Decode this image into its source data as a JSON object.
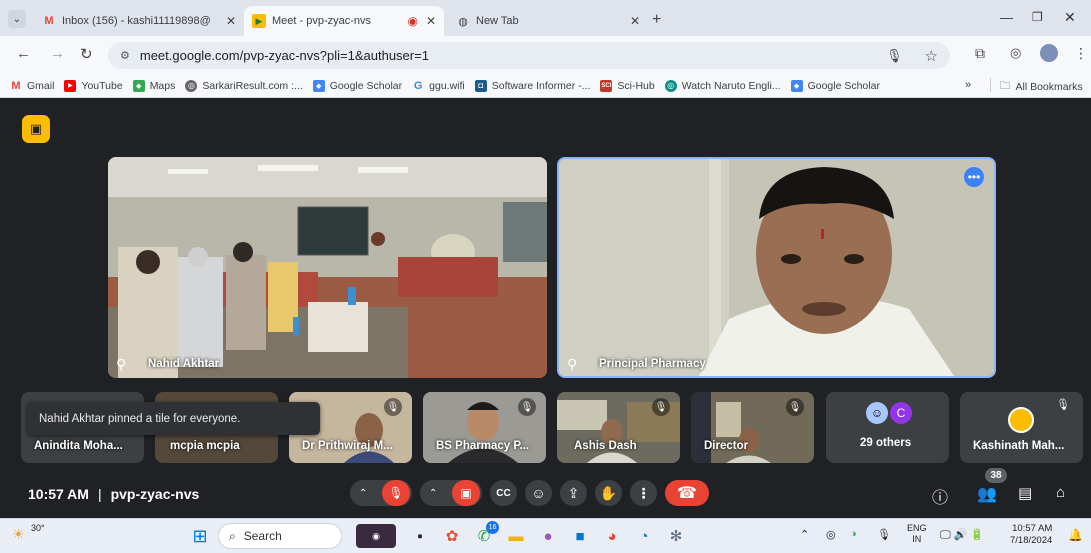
{
  "browser": {
    "tabs": [
      {
        "title": "Inbox (156) - kashi11119898@"
      },
      {
        "title": "Meet - pvp-zyac-nvs"
      },
      {
        "title": "New Tab"
      }
    ],
    "url": "meet.google.com/pvp-zyac-nvs?pli=1&authuser=1",
    "bookmarks": [
      "Gmail",
      "YouTube",
      "Maps",
      "SarkariResult.com :...",
      "Google Scholar",
      "ggu.wifi",
      "Software Informer -...",
      "Sci-Hub",
      "Watch Naruto Engli...",
      "Google Scholar"
    ],
    "all_bookmarks": "All Bookmarks"
  },
  "meet": {
    "main_tiles": [
      {
        "name": "Nahid Akhtar"
      },
      {
        "name": "Principal Pharmacy"
      }
    ],
    "toast": "Nahid Akhtar pinned a tile for everyone.",
    "small_tiles": [
      {
        "name": "Anindita Moha..."
      },
      {
        "name": "mcpia mcpia"
      },
      {
        "name": "Dr Prithwiraj M..."
      },
      {
        "name": "BS Pharmacy P..."
      },
      {
        "name": "Ashis Dash"
      },
      {
        "name": "Director"
      },
      {
        "name": "29 others",
        "avatar_letter": "C"
      },
      {
        "name": "Kashinath Mah..."
      }
    ],
    "time": "10:57 AM",
    "separator": "|",
    "code": "pvp-zyac-nvs",
    "people_count": "38"
  },
  "taskbar": {
    "temp": "30°",
    "search": "Search",
    "lang1": "ENG",
    "lang2": "IN",
    "time": "10:57 AM",
    "date": "7/18/2024",
    "badge": "16"
  }
}
